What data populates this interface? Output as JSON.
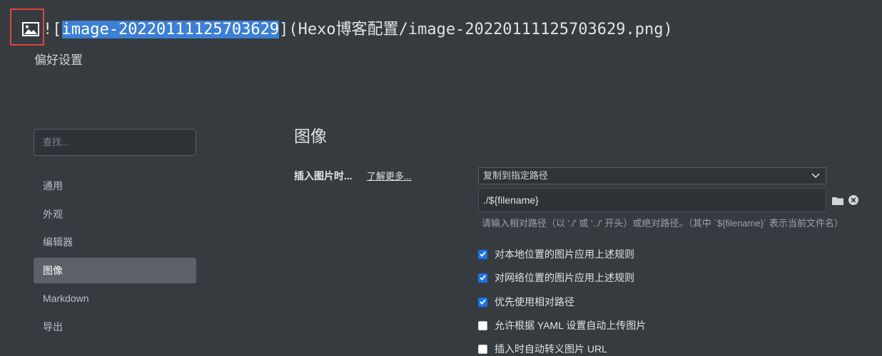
{
  "editor": {
    "bang_bracket": "![",
    "alt_text": "image-20220111125703629",
    "tail": "](Hexo博客配置/image-20220111125703629.png)"
  },
  "preferences": {
    "title": "偏好设置",
    "search_placeholder": "查找...",
    "nav": [
      {
        "label": "通用"
      },
      {
        "label": "外观"
      },
      {
        "label": "编辑器"
      },
      {
        "label": "图像",
        "active": true
      },
      {
        "label": "Markdown"
      },
      {
        "label": "导出"
      }
    ]
  },
  "image_section": {
    "title": "图像",
    "insert_label": "插入图片时...",
    "learn_more": "了解更多...",
    "action_selected": "复制到指定路径",
    "path_value": "./${filename}",
    "hint": "请输入相对路径（以 './' 或 '../' 开头）或绝对路径。（其中 `${filename}` 表示当前文件名）",
    "options": [
      {
        "label": "对本地位置的图片应用上述规则",
        "checked": true
      },
      {
        "label": "对网络位置的图片应用上述规则",
        "checked": true
      },
      {
        "label": "优先使用相对路径",
        "checked": true
      },
      {
        "label": "允许根据 YAML 设置自动上传图片",
        "checked": false
      },
      {
        "label": "插入时自动转义图片 URL",
        "checked": false
      }
    ]
  },
  "colors": {
    "background": "#363b40",
    "selection": "#3c7fd4",
    "highlight_box": "#e0443e",
    "checkbox_on": "#1a73e8"
  }
}
